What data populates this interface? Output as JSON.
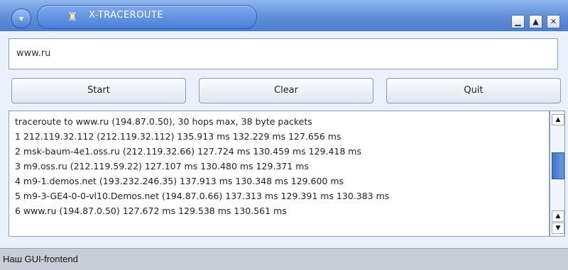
{
  "window": {
    "title": "X-TRACEROUTE",
    "menu_glyph": "▾",
    "app_icon_glyph": "♜",
    "controls": {
      "minimize": "▁",
      "maximize": "▲",
      "close": "✕"
    }
  },
  "form": {
    "host_value": "www.ru"
  },
  "buttons": {
    "start": "Start",
    "clear": "Clear",
    "quit": "Quit"
  },
  "output": {
    "lines": [
      "traceroute to www.ru (194.87.0.50), 30 hops max, 38 byte packets",
      " 1  212.119.32.112 (212.119.32.112)  135.913 ms  132.229 ms  127.656 ms",
      " 2  msk-baum-4e1.oss.ru (212.119.32.66)  127.724 ms  130.459 ms  129.418 ms",
      " 3  m9.oss.ru (212.119.59.22)  127.107 ms  130.480 ms  129.371 ms",
      " 4  m9-1.demos.net (193.232.246.35)  137.913 ms  130.348 ms  129.600 ms",
      " 5  m9-3-GE4-0-0-vl10.Demos.net (194.87.0.66)  137.313 ms  129.391 ms  130.383 ms",
      " 6  www.ru (194.87.0.50)  127.672 ms  129.538 ms  130.561 ms"
    ],
    "scroll": {
      "up": "▲",
      "down": "▼"
    }
  },
  "caption": "Наш GUI-frontend",
  "colors": {
    "titlebar": "#5f8fd8",
    "background": "#6f9ad8",
    "caption_bg": "#c9ced6"
  }
}
